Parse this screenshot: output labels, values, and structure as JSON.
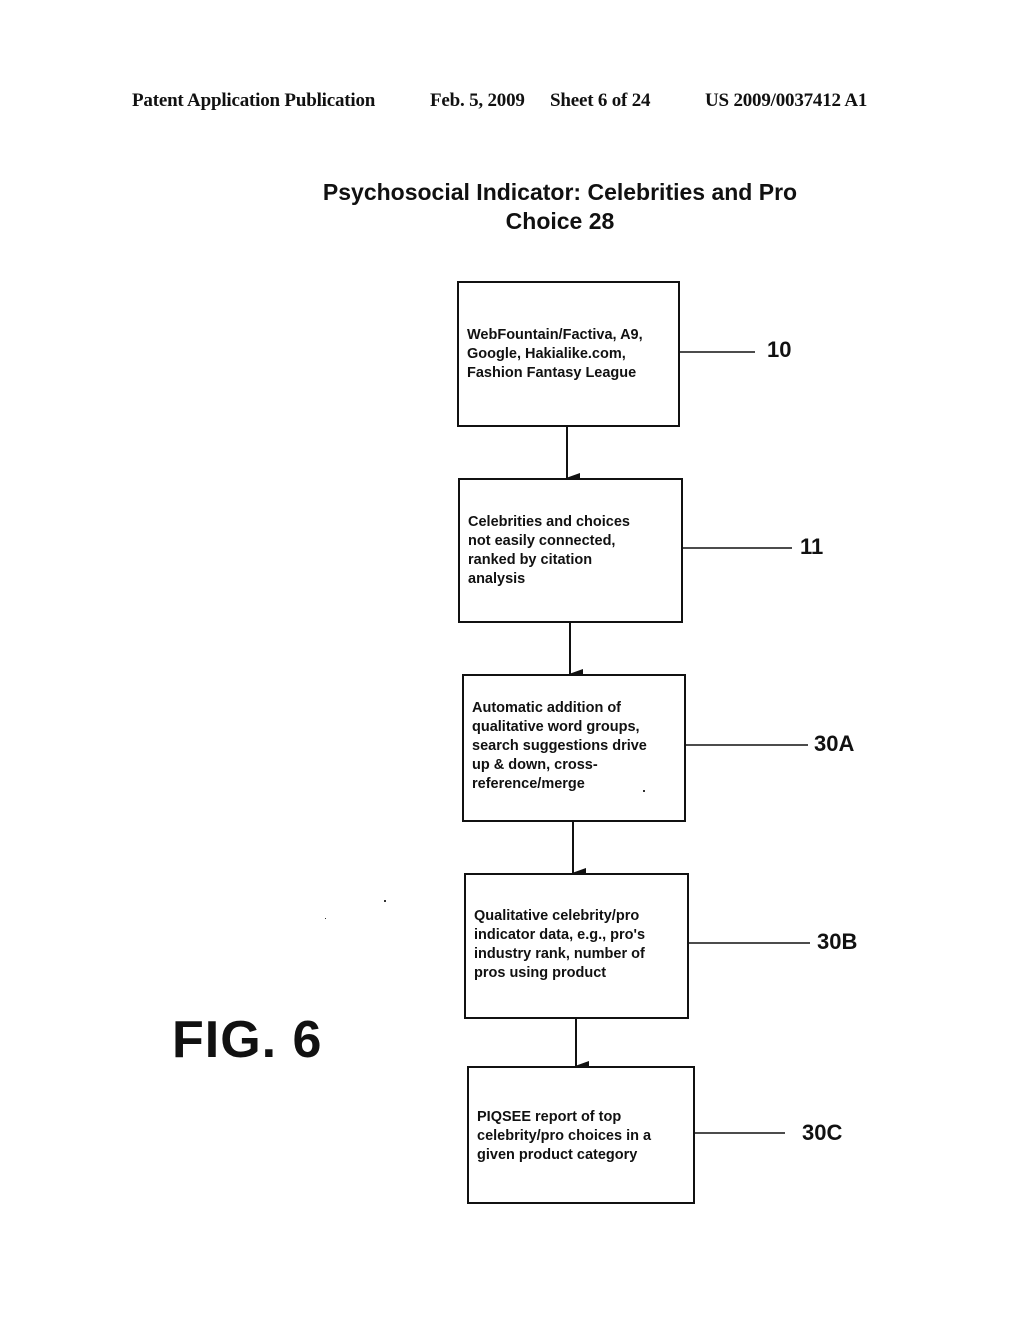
{
  "header": {
    "publication": "Patent Application Publication",
    "date": "Feb. 5, 2009",
    "sheet": "Sheet 6 of 24",
    "patent_number": "US 2009/0037412 A1"
  },
  "diagram": {
    "title_line1": "Psychosocial Indicator: Celebrities and Pro",
    "title_line2": "Choice 28",
    "figure_label": "FIG. 6",
    "steps": [
      {
        "ref": "10",
        "text": "WebFountain/Factiva, A9,\nGoogle, Hakialike.com,\nFashion Fantasy League"
      },
      {
        "ref": "11",
        "text": "Celebrities and choices\nnot easily connected,\nranked by citation\nanalysis"
      },
      {
        "ref": "30A",
        "text": "Automatic addition of\nqualitative word groups,\nsearch suggestions drive\nup & down, cross-\nreference/merge"
      },
      {
        "ref": "30B",
        "text": "Qualitative celebrity/pro\nindicator data, e.g., pro's\nindustry rank, number of\npros using product"
      },
      {
        "ref": "30C",
        "text": "PIQSEE report of top\ncelebrity/pro choices in a\ngiven product category"
      }
    ],
    "connections": [
      {
        "from": "10",
        "to": "11"
      },
      {
        "from": "11",
        "to": "30A"
      },
      {
        "from": "30A",
        "to": "30B"
      },
      {
        "from": "30B",
        "to": "30C"
      }
    ]
  }
}
